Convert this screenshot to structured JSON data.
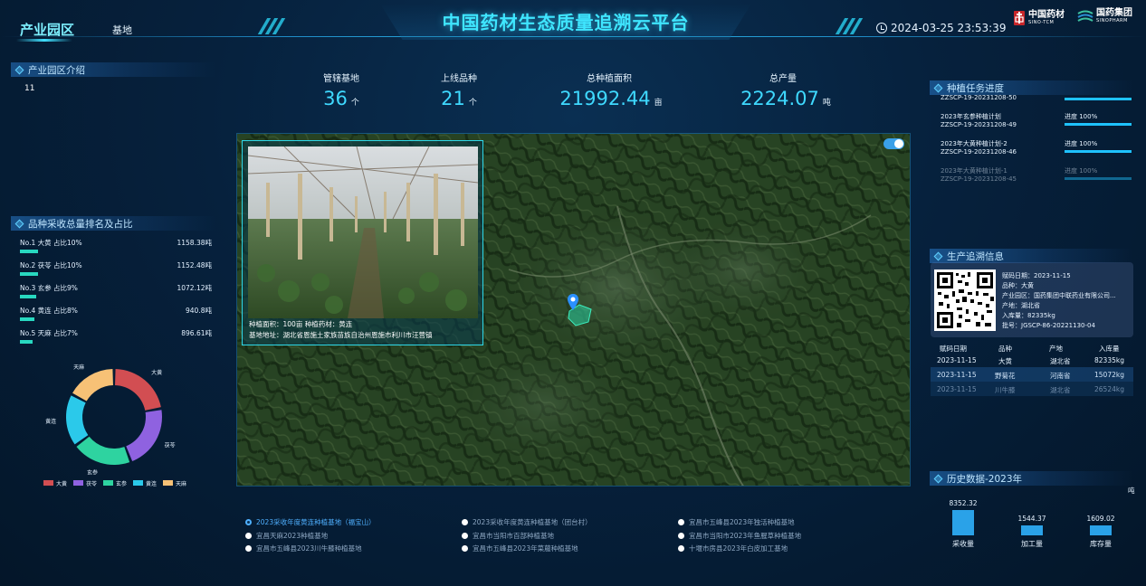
{
  "header": {
    "title": "中国药材生态质量追溯云平台",
    "tab_active": "产业园区",
    "tab_second": "基地",
    "datetime": "2024-03-25 23:53:39",
    "logo1_name": "中国药材",
    "logo1_sub": "SINO-TCM",
    "logo2_name": "国药集团",
    "logo2_sub": "SINOPHARM"
  },
  "intro": {
    "title": "产业园区介绍",
    "text": "11"
  },
  "stats": [
    {
      "label": "管辖基地",
      "value": "36",
      "unit": "个"
    },
    {
      "label": "上线品种",
      "value": "21",
      "unit": "个"
    },
    {
      "label": "总种植面积",
      "value": "21992.44",
      "unit": "亩"
    },
    {
      "label": "总产量",
      "value": "2224.07",
      "unit": "吨"
    }
  ],
  "ranking": {
    "title": "品种采收总量排名及占比",
    "rows": [
      {
        "label": "No.1 大黄 占比10%",
        "value": "1158.38吨",
        "fraction": 0.1
      },
      {
        "label": "No.2 茯苓 占比10%",
        "value": "1152.48吨",
        "fraction": 0.1
      },
      {
        "label": "No.3 玄参 占比9%",
        "value": "1072.12吨",
        "fraction": 0.09
      },
      {
        "label": "No.4 黄连 占比8%",
        "value": "940.8吨",
        "fraction": 0.08
      },
      {
        "label": "No.5 天麻 占比7%",
        "value": "896.61吨",
        "fraction": 0.07
      }
    ]
  },
  "chart_data": {
    "type": "pie",
    "categories": [
      "大黄",
      "茯苓",
      "玄参",
      "黄连",
      "天麻"
    ],
    "values": [
      1158.38,
      1152.48,
      1072.12,
      940.8,
      896.61
    ],
    "colors": [
      "#d24e52",
      "#8f62e0",
      "#2ed3a0",
      "#2bc9ea",
      "#f7c176"
    ],
    "legend": "bottom"
  },
  "map": {
    "photo_caption_line1": "种植面积：100亩    种植药材：黄连",
    "photo_caption_line2": "基地地址：湖北省恩施土家族苗族自治州恩施市利川市汪营镇"
  },
  "bases": [
    {
      "label": "2023采收年度黄连种植基地（福宝山）",
      "active": true
    },
    {
      "label": "2023采收年度黄连种植基地（团台村）",
      "active": false
    },
    {
      "label": "宜昌市五峰县2023年独活种植基地",
      "active": false
    },
    {
      "label": "宜昌天麻2023种植基地",
      "active": false
    },
    {
      "label": "宜昌市当阳市百部种植基地",
      "active": false
    },
    {
      "label": "宜昌市当阳市2023年鱼腥草种植基地",
      "active": false
    },
    {
      "label": "宜昌市五峰县2023川牛膝种植基地",
      "active": false
    },
    {
      "label": "宜昌市五峰县2023年菜菔种植基地",
      "active": false
    },
    {
      "label": "十堰市房县2023年白皮加工基地",
      "active": false
    }
  ],
  "tasks": {
    "title": "种植任务进度",
    "items": [
      {
        "name": "",
        "code": "ZZSCP-19-20231208-50",
        "progress": ""
      },
      {
        "name": "2023年玄参种植计划",
        "code": "ZZSCP-19-20231208-49",
        "progress": "进度 100%"
      },
      {
        "name": "2023年大黄种植计划-2",
        "code": "ZZSCP-19-20231208-46",
        "progress": "进度 100%"
      },
      {
        "name": "2023年大黄种植计划-1",
        "code": "ZZSCP-19-20231208-45",
        "progress": "进度 100%"
      }
    ]
  },
  "trace": {
    "title": "生产追溯信息",
    "lines": [
      "赋码日期：2023-11-15",
      "品种：大黄",
      "产业园区：国药集团中联药业有限公司...",
      "产地：湖北省",
      "入库量：82335kg",
      "批号：JGSCP-86-20221130-04"
    ],
    "table_headers": [
      "赋码日期",
      "品种",
      "产地",
      "入库量"
    ],
    "table_rows": [
      [
        "2023-11-15",
        "大黄",
        "湖北省",
        "82335kg"
      ],
      [
        "2023-11-15",
        "野菊花",
        "河南省",
        "15072kg"
      ],
      [
        "2023-11-15",
        "川牛膝",
        "湖北省",
        "26524kg"
      ]
    ]
  },
  "history": {
    "title": "历史数据-2023年",
    "unit": "吨",
    "bars": [
      {
        "label": "采收量",
        "value": 8352.32,
        "text": "8352.32"
      },
      {
        "label": "加工量",
        "value": 1544.37,
        "text": "1544.37"
      },
      {
        "label": "库存量",
        "value": 1609.02,
        "text": "1609.02"
      }
    ]
  }
}
